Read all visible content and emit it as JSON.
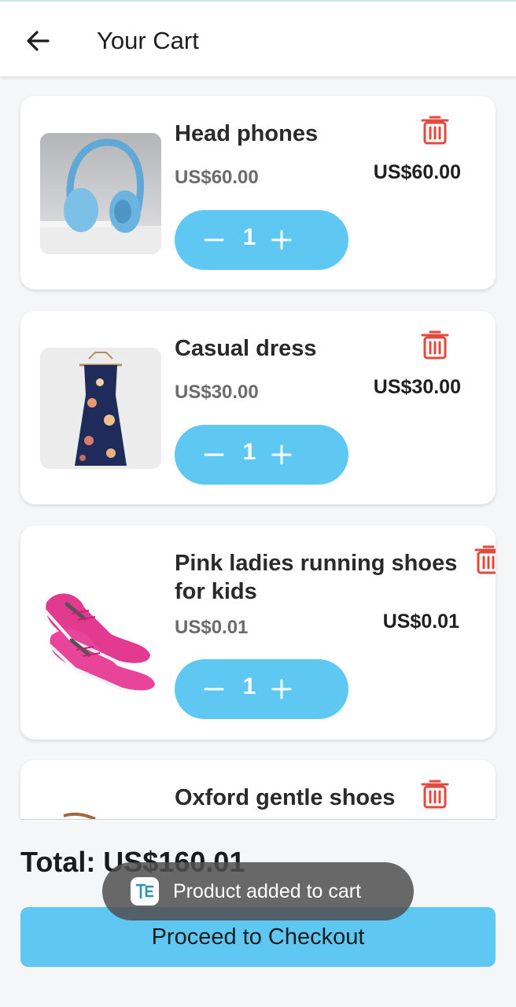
{
  "app": {
    "title": "Your Cart"
  },
  "cart": {
    "items": [
      {
        "name": "Head phones",
        "unit_price": "US$60.00",
        "line_total": "US$60.00",
        "quantity": "1",
        "image": "headphones-image"
      },
      {
        "name": "Casual dress",
        "unit_price": "US$30.00",
        "line_total": "US$30.00",
        "quantity": "1",
        "image": "dress-image"
      },
      {
        "name": "Pink ladies running shoes for kids",
        "unit_price": "US$0.01",
        "line_total": "US$0.01",
        "quantity": "1",
        "image": "pink-shoes-image"
      },
      {
        "name": "Oxford gentle shoes",
        "image": "oxford-shoes-image"
      }
    ],
    "total_label": "Total: US$160.01",
    "checkout_label": "Proceed to Checkout"
  },
  "toast": {
    "message": "Product added to cart"
  },
  "colors": {
    "accent": "#5ec8f2",
    "delete": "#e5483d",
    "card": "#ffffff",
    "background": "#f5f6f7"
  },
  "icons": [
    "back-arrow-icon",
    "trash-icon",
    "minus-icon",
    "plus-icon",
    "app-icon"
  ]
}
